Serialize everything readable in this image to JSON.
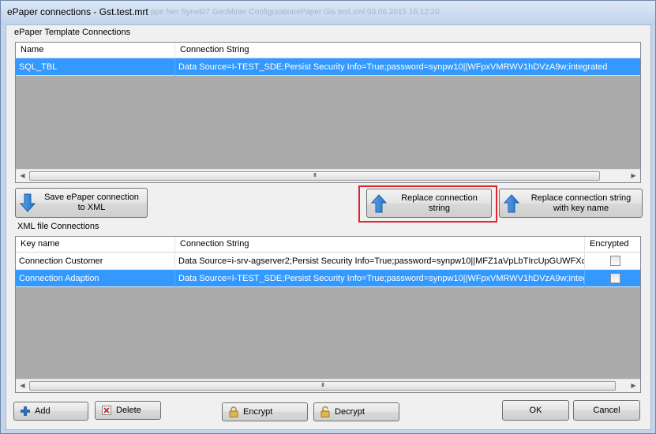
{
  "window": {
    "title": "ePaper connections - Gst.test.mrt",
    "ghost_text": "ppe Ner Synet07 GeoMiner ConfigurationePaper Gis test.xml    03.06.2015 16:12:20"
  },
  "template_group": {
    "label": "ePaper Template Connections",
    "columns": [
      "Name",
      "Connection String"
    ],
    "rows": [
      {
        "name": "SQL_TBL",
        "connection": "Data Source=I-TEST_SDE;Persist Security Info=True;password=synpw10||WFpxVMRWV1hDVzA9w;integrated",
        "selected": true
      }
    ],
    "scroll_thumb": "III"
  },
  "buttons_mid": {
    "save": "Save ePaper connection\nto XML",
    "replace": "Replace connection\nstring",
    "replace_key": "Replace connection string\nwith key name"
  },
  "xml_group": {
    "label": "XML file Connections",
    "columns": [
      "Key name",
      "Connection String",
      "Encrypted"
    ],
    "rows": [
      {
        "key": "Connection Customer",
        "connection": "Data Source=i-srv-agserver2;Persist Security Info=True;password=synpw10||MFZ1aVpLbTIrcUpGUWFXcz...",
        "encrypted": false,
        "selected": false
      },
      {
        "key": "Connection Adaption",
        "connection": "Data Source=I-TEST_SDE;Persist Security Info=True;password=synpw10||WFpxVMRWV1hDVzA9w;integ...",
        "encrypted": false,
        "selected": true
      }
    ],
    "scroll_thumb": "III"
  },
  "buttons_bottom": {
    "add": "Add",
    "delete": "Delete",
    "encrypt": "Encrypt",
    "decrypt": "Decrypt",
    "ok": "OK",
    "cancel": "Cancel"
  },
  "colors": {
    "selection": "#3399ff",
    "highlight_border": "#e0242a",
    "grid_empty": "#ababab"
  }
}
